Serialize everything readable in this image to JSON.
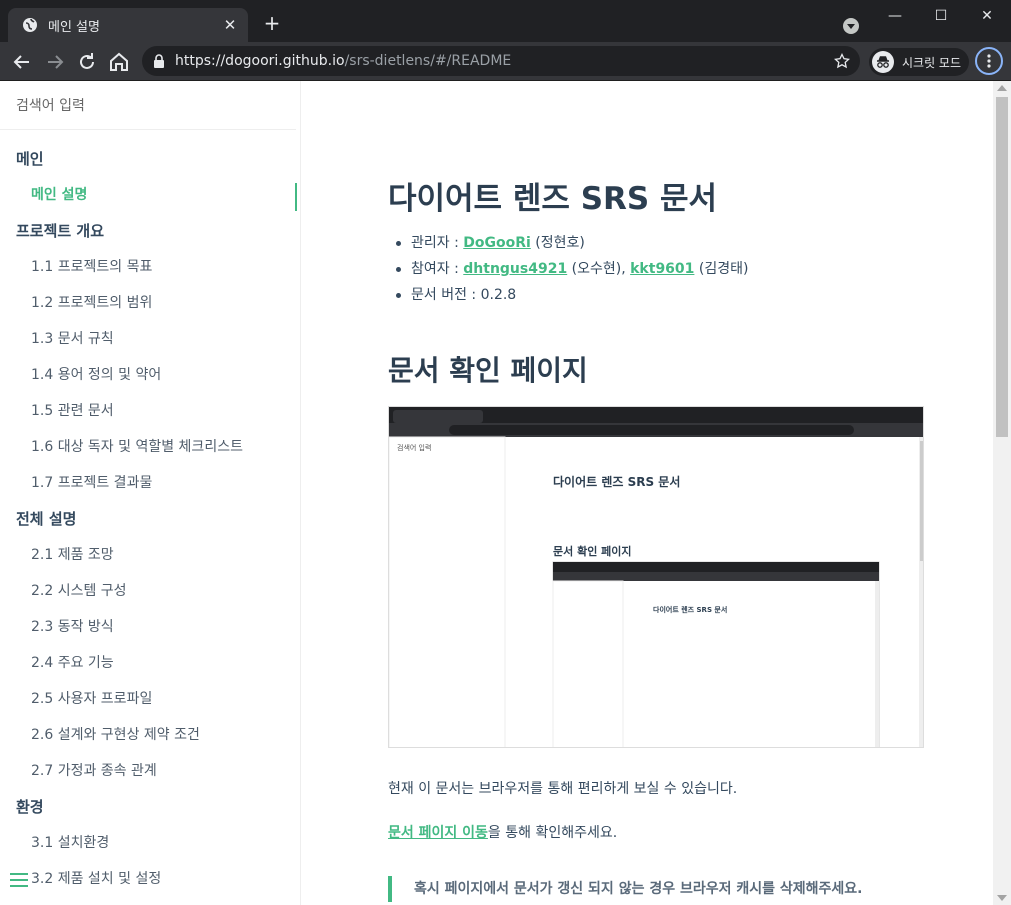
{
  "browser": {
    "tab_title": "메인 설명",
    "url_domain": "https://dogoori.github.io",
    "url_path": "/srs-dietlens/#/README",
    "incognito_label": "시크릿 모드",
    "accent": "#8ab4f8"
  },
  "sidebar": {
    "search_placeholder": "검색어 입력",
    "sections": [
      {
        "title": "메인",
        "items": [
          "메인 설명"
        ]
      },
      {
        "title": "프로젝트 개요",
        "items": [
          "1.1 프로젝트의 목표",
          "1.2 프로젝트의 범위",
          "1.3 문서 규칙",
          "1.4 용어 정의 및 약어",
          "1.5 관련 문서",
          "1.6 대상 독자 및 역할별 체크리스트",
          "1.7 프로젝트 결과물"
        ]
      },
      {
        "title": "전체 설명",
        "items": [
          "2.1 제품 조망",
          "2.2 시스템 구성",
          "2.3 동작 방식",
          "2.4 주요 기능",
          "2.5 사용자 프로파일",
          "2.6 설계와 구현상 제약 조건",
          "2.7 가정과 종속 관계"
        ]
      },
      {
        "title": "환경",
        "items": [
          "3.1 설치환경",
          "3.2 제품 설치 및 설정"
        ]
      }
    ],
    "active_item": "메인 설명",
    "accent": "#42b983"
  },
  "content": {
    "title": "다이어트 렌즈 SRS 문서",
    "admin_label": "관리자 : ",
    "admin_link": "DoGooRi",
    "admin_name": " (정현호)",
    "contrib_label": "참여자 : ",
    "contrib_link1": "dhtngus4921",
    "contrib_name1": " (오수현), ",
    "contrib_link2": "kkt9601",
    "contrib_name2": " (김경태)",
    "version_label": "문서 버전 : 0.2.8",
    "section_title": "문서 확인 페이지",
    "para1": "현재 이 문서는 브라우저를 통해 편리하게 보실 수 있습니다.",
    "para2_link": "문서 페이지 이동",
    "para2_rest": "을 통해 확인해주세요.",
    "blockquote": "혹시 페이지에서 문서가 갱신 되지 않는 경우 브라우저 캐시를 삭제해주세요."
  }
}
